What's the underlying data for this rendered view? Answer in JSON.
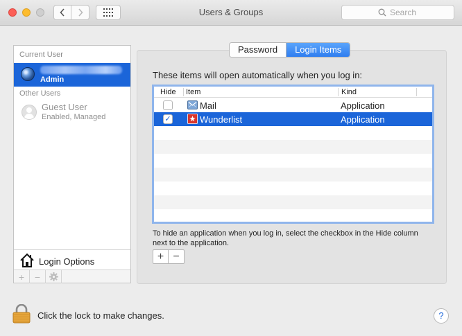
{
  "window": {
    "title": "Users & Groups"
  },
  "toolbar": {
    "back_icon": "chevron-left-icon",
    "forward_icon": "chevron-right-icon",
    "show_all_icon": "grid-icon",
    "search_placeholder": "Search"
  },
  "sidebar": {
    "current_user_header": "Current User",
    "current_user": {
      "role": "Admin",
      "avatar": "globe-icon"
    },
    "other_users_header": "Other Users",
    "other_users": [
      {
        "name": "Guest User",
        "status": "Enabled, Managed"
      }
    ],
    "login_options_label": "Login Options",
    "bottom_buttons": [
      "+",
      "−",
      "gear-icon"
    ]
  },
  "tabs": [
    {
      "label": "Password",
      "selected": false
    },
    {
      "label": "Login Items",
      "selected": true
    }
  ],
  "login_items": {
    "intro": "These items will open automatically when you log in:",
    "columns": {
      "hide": "Hide",
      "item": "Item",
      "kind": "Kind"
    },
    "rows": [
      {
        "hidden": false,
        "name": "Mail",
        "kind": "Application",
        "icon": "mail-icon",
        "selected": false
      },
      {
        "hidden": true,
        "name": "Wunderlist",
        "kind": "Application",
        "icon": "wunderlist-icon",
        "selected": true
      }
    ],
    "hint": "To hide an application when you log in, select the checkbox in the Hide column next to the application.",
    "add_label": "+",
    "remove_label": "−",
    "checkmark": "✓"
  },
  "footer": {
    "lock_text": "Click the lock to make changes.",
    "help_label": "?"
  },
  "colors": {
    "selection": "#1b65d9",
    "tab_selected": "#3a88f5",
    "lock": "#e7a63b"
  }
}
